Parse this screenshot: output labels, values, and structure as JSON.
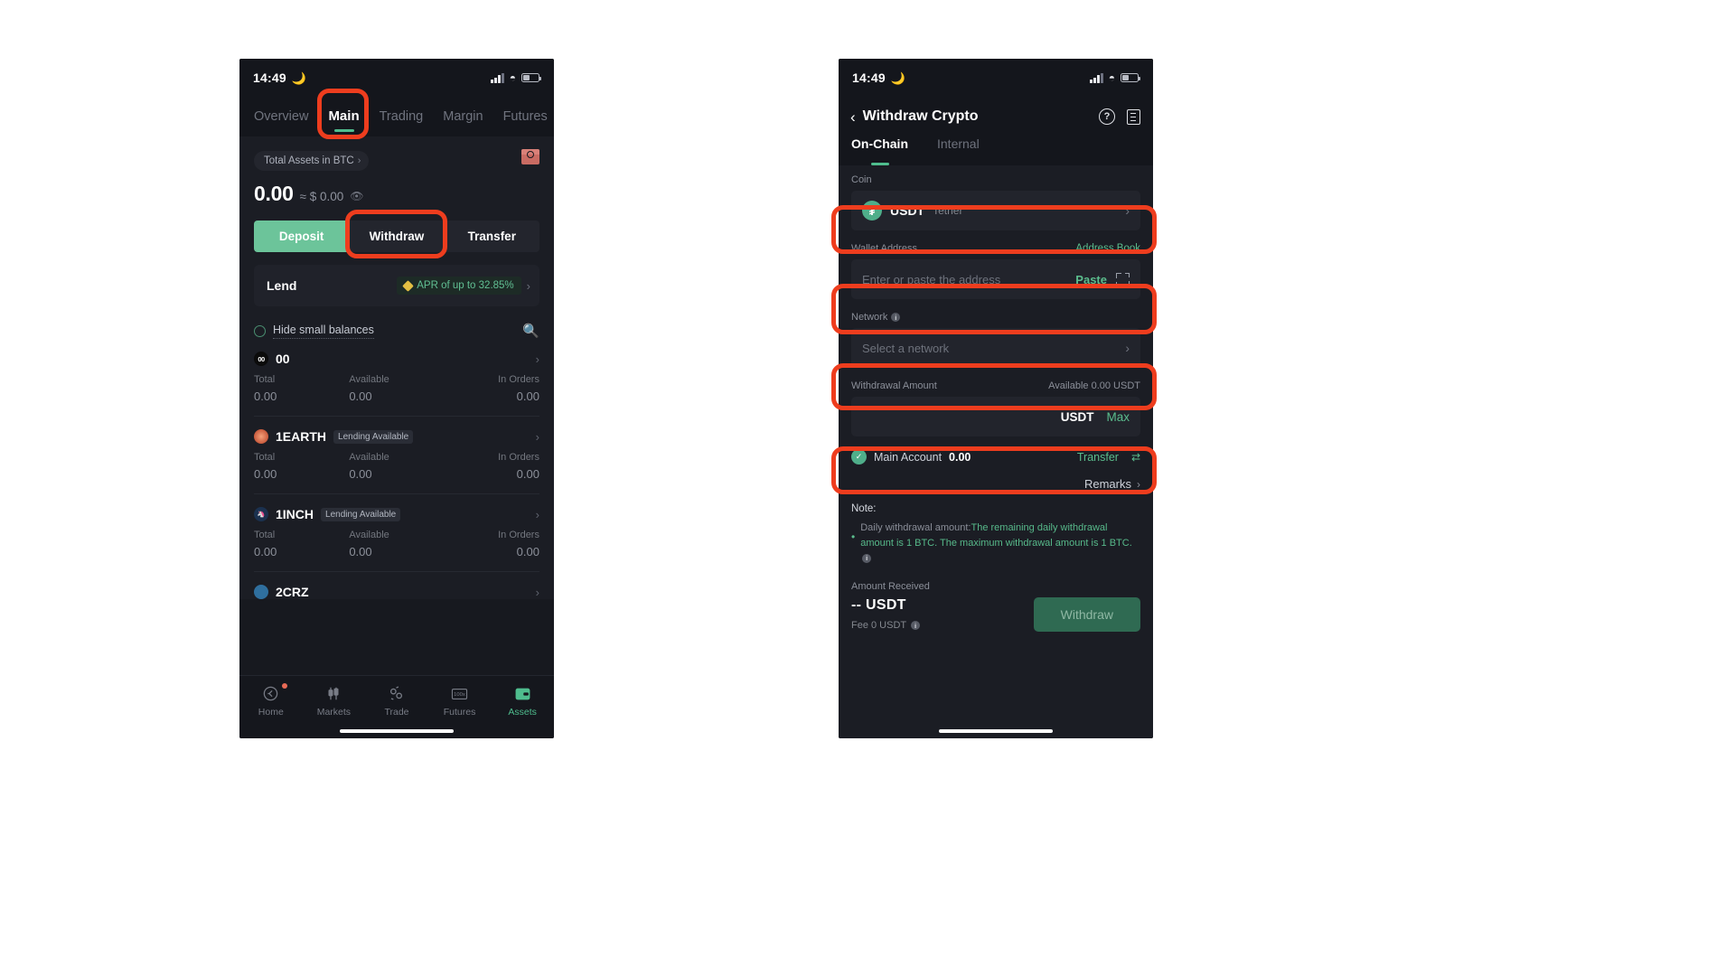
{
  "left_phone": {
    "status": {
      "time": "14:49",
      "moon_icon": "moon-icon"
    },
    "top_tabs": [
      {
        "label": "Overview",
        "active": false
      },
      {
        "label": "Main",
        "active": true
      },
      {
        "label": "Trading",
        "active": false
      },
      {
        "label": "Margin",
        "active": false
      },
      {
        "label": "Futures",
        "active": false
      }
    ],
    "assets": {
      "selector_label": "Total Assets in BTC",
      "balance": "0.00",
      "approx": "≈ $ 0.00",
      "eye_icon": "eye-icon",
      "gift_icon": "gift-box-icon"
    },
    "actions": [
      {
        "label": "Deposit",
        "style": "primary"
      },
      {
        "label": "Withdraw",
        "style": "ghost"
      },
      {
        "label": "Transfer",
        "style": "ghost"
      }
    ],
    "lend": {
      "title": "Lend",
      "apr_text": "APR of up to 32.85%",
      "chevron": "›"
    },
    "hide_small_balances": {
      "label": "Hide small balances",
      "checked": false,
      "search_icon": "search-icon"
    },
    "coin_columns": [
      "Total",
      "Available",
      "In Orders"
    ],
    "coins": [
      {
        "symbol": "00",
        "tag": "",
        "icon": "coin-00-icon",
        "total": "0.00",
        "available": "0.00",
        "in_orders": "0.00"
      },
      {
        "symbol": "1EARTH",
        "tag": "Lending Available",
        "icon": "coin-1earth-icon",
        "total": "0.00",
        "available": "0.00",
        "in_orders": "0.00"
      },
      {
        "symbol": "1INCH",
        "tag": "Lending Available",
        "icon": "coin-1inch-icon",
        "total": "0.00",
        "available": "0.00",
        "in_orders": "0.00"
      },
      {
        "symbol": "2CRZ",
        "tag": "",
        "icon": "coin-2crz-icon",
        "total": "",
        "available": "",
        "in_orders": ""
      }
    ],
    "bottom_nav": [
      {
        "label": "Home",
        "icon": "home-kucoin-icon",
        "active": false,
        "badge": true
      },
      {
        "label": "Markets",
        "icon": "candlestick-icon",
        "active": false,
        "badge": false
      },
      {
        "label": "Trade",
        "icon": "trade-swap-icon",
        "active": false,
        "badge": false
      },
      {
        "label": "Futures",
        "icon": "futures-100x-icon",
        "active": false,
        "badge": false
      },
      {
        "label": "Assets",
        "icon": "assets-wallet-icon",
        "active": true,
        "badge": false
      }
    ]
  },
  "right_phone": {
    "status": {
      "time": "14:49",
      "moon_icon": "moon-icon"
    },
    "header": {
      "back_icon": "back-chevron-icon",
      "title": "Withdraw Crypto",
      "help_icon": "question-circle-icon",
      "records_icon": "document-records-icon"
    },
    "tabs": [
      {
        "label": "On-Chain",
        "active": true
      },
      {
        "label": "Internal",
        "active": false
      }
    ],
    "coin_field": {
      "label": "Coin",
      "symbol": "USDT",
      "name": "Tether",
      "badge_letter": "₮",
      "chevron": "›"
    },
    "wallet_address": {
      "label": "Wallet Address",
      "address_book_link": "Address Book",
      "placeholder": "Enter or paste the address",
      "value": "",
      "paste_label": "Paste",
      "scan_icon": "scan-qr-icon"
    },
    "network": {
      "label": "Network",
      "info_icon": "info-icon",
      "placeholder": "Select a network",
      "value": "",
      "chevron": "›"
    },
    "withdrawal_amount": {
      "label": "Withdrawal Amount",
      "available_text": "Available 0.00 USDT",
      "value": "",
      "unit": "USDT",
      "max_label": "Max"
    },
    "main_account": {
      "check_icon": "check-circle-icon",
      "label": "Main Account",
      "value": "0.00",
      "transfer_label": "Transfer",
      "swap_icon": "swap-arrows-icon"
    },
    "remarks": {
      "label": "Remarks",
      "chevron": "›"
    },
    "note": {
      "title": "Note:",
      "bullet": "•",
      "grey_part": "Daily withdrawal amount:",
      "green_part": "The remaining daily withdrawal amount is 1  BTC. The maximum withdrawal amount is 1 BTC.",
      "info_icon": "info-icon"
    },
    "amount_received": {
      "label": "Amount Received",
      "value": "-- USDT",
      "fee": "Fee 0 USDT",
      "info_icon": "info-icon"
    },
    "withdraw_button": {
      "label": "Withdraw",
      "enabled": false
    }
  },
  "annotations": {
    "highlight_color": "#ee3d1e",
    "boxes": [
      {
        "name": "main-tab-highlight"
      },
      {
        "name": "withdraw-button-highlight"
      },
      {
        "name": "coin-field-highlight"
      },
      {
        "name": "wallet-address-highlight"
      },
      {
        "name": "network-field-highlight"
      },
      {
        "name": "amount-field-highlight"
      }
    ]
  }
}
